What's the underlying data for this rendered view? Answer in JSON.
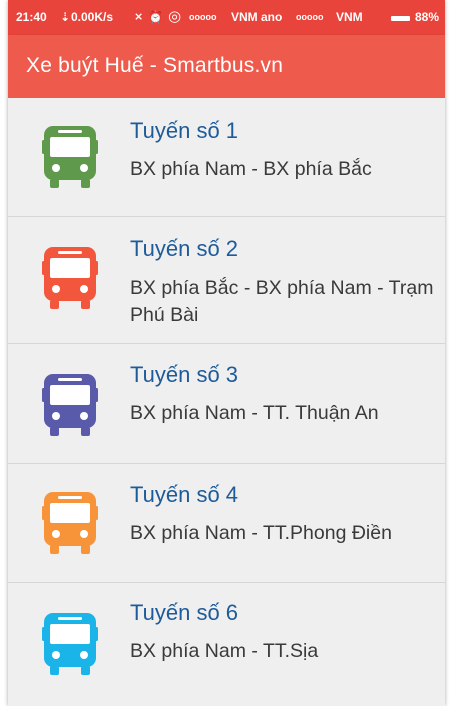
{
  "status_bar": {
    "time": "21:40",
    "net_speed": "0.00K/s",
    "carrier1": "VNM ano",
    "carrier2": "VNM",
    "battery": "88%"
  },
  "app_bar": {
    "title": "Xe buýt Huế - Smartbus.vn"
  },
  "routes": [
    {
      "name": "Tuyến số 1",
      "desc": "BX phía Nam - BX phía Bắc",
      "color": "#5f9a4c"
    },
    {
      "name": "Tuyến số 2",
      "desc": "BX phía Bắc - BX phía Nam - Trạm Phú Bài",
      "color": "#f2573d"
    },
    {
      "name": "Tuyến số 3",
      "desc": "BX phía Nam - TT. Thuận An",
      "color": "#5a5aab"
    },
    {
      "name": "Tuyến số 4",
      "desc": "BX phía Nam - TT.Phong Điền",
      "color": "#f7943a"
    },
    {
      "name": "Tuyến số 6",
      "desc": "BX phía Nam - TT.Sịa",
      "color": "#1ab4e8"
    }
  ]
}
